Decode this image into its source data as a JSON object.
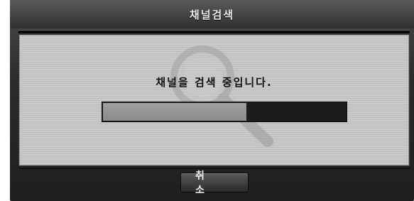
{
  "dialog": {
    "title": "채널검색",
    "message": "채널을 검색 중입니다.",
    "progress_fraction": 0.59,
    "cancel_label": "취 소"
  },
  "colors": {
    "title_bar": "#3a3a3a",
    "content_bg": "#c4c4c4",
    "progress_track": "#1c1c1c",
    "progress_fill": "#949494"
  },
  "icons": {
    "watermark": "magnifier-icon"
  }
}
